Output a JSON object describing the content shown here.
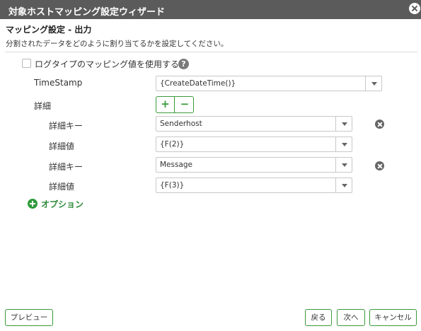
{
  "window": {
    "title": "対象ホストマッピング設定ウィザード"
  },
  "section": {
    "title": "マッピング設定 - 出力",
    "description": "分割されたデータをどのように割り当てるかを設定してください。"
  },
  "log_type_checkbox": {
    "label": "ログタイプのマッピング値を使用する",
    "checked": false
  },
  "help": {
    "glyph": "?"
  },
  "timestamp": {
    "label": "TimeStamp",
    "value": "{CreateDateTime()}"
  },
  "details": {
    "label": "詳細",
    "add_glyph": "+",
    "remove_glyph": "−",
    "rows": [
      {
        "label": "詳細キー",
        "value": "Senderhost"
      },
      {
        "label": "詳細値",
        "value": "{F(2)}"
      },
      {
        "label": "詳細キー",
        "value": "Message"
      },
      {
        "label": "詳細値",
        "value": "{F(3)}"
      }
    ]
  },
  "option": {
    "label": "オプション"
  },
  "footer": {
    "preview": "プレビュー",
    "back": "戻る",
    "next": "次へ",
    "cancel": "キャンセル"
  },
  "colors": {
    "titlebar": "#5b5b5b",
    "accent_green": "#3a9a3a"
  }
}
